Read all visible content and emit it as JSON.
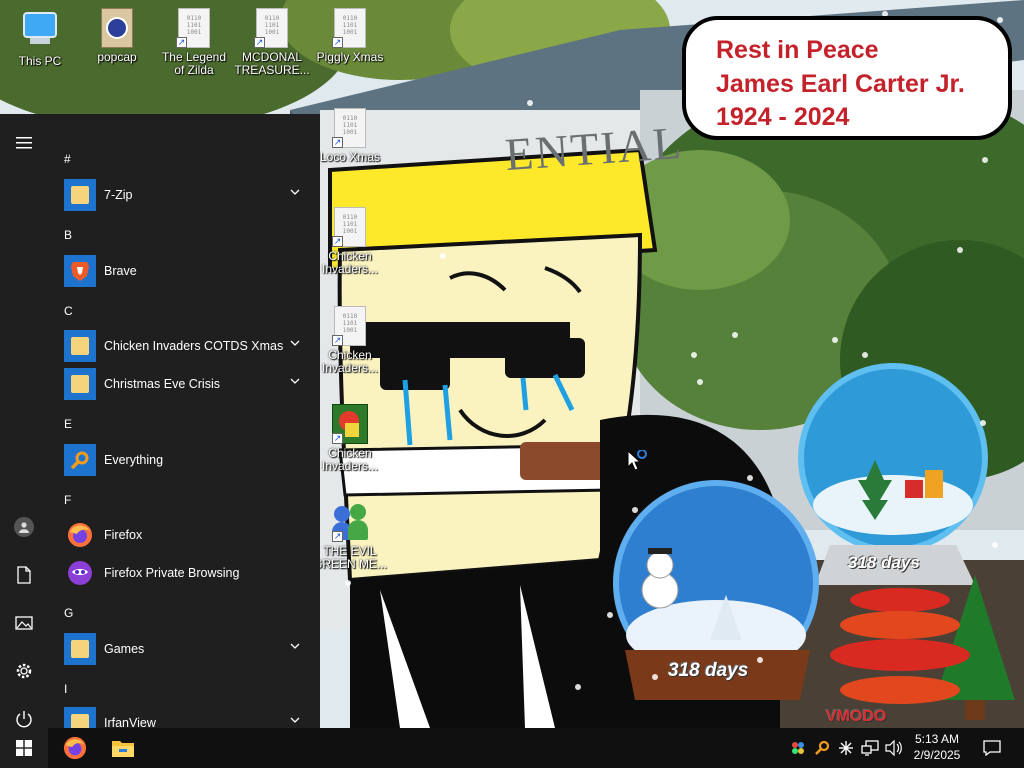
{
  "desktop": {
    "icons": [
      {
        "label": "This PC"
      },
      {
        "label": "popcap"
      },
      {
        "label": "The Legend of Zilda"
      },
      {
        "label": "MCDONAL TREASURE..."
      },
      {
        "label": "Piggly Xmas"
      },
      {
        "label": "Loco Xmas"
      },
      {
        "label": "Chicken Invaders..."
      },
      {
        "label": "Chicken Invaders..."
      },
      {
        "label": "Chicken Invaders..."
      },
      {
        "label": "THE EVIL GREEN ME..."
      }
    ]
  },
  "wallpaper": {
    "bubble": {
      "line1": "Rest in Peace",
      "line2": "James Earl Carter Jr.",
      "line3": "1924 - 2024"
    },
    "building_sign": "ENTIAL",
    "globe_days_right": "318 days",
    "globe_days_left": "318 days",
    "watermark": "VMODO"
  },
  "start_menu": {
    "groups": [
      {
        "letter": "#",
        "apps": [
          {
            "name": "7-Zip",
            "icon": "folder-icon",
            "expandable": true
          }
        ]
      },
      {
        "letter": "B",
        "apps": [
          {
            "name": "Brave",
            "icon": "brave-icon",
            "expandable": false
          }
        ]
      },
      {
        "letter": "C",
        "apps": [
          {
            "name": "Chicken Invaders COTDS Xmas",
            "icon": "folder-icon",
            "expandable": true
          },
          {
            "name": "Christmas Eve Crisis",
            "icon": "folder-icon",
            "expandable": true
          }
        ]
      },
      {
        "letter": "E",
        "apps": [
          {
            "name": "Everything",
            "icon": "everything-icon",
            "expandable": false
          }
        ]
      },
      {
        "letter": "F",
        "apps": [
          {
            "name": "Firefox",
            "icon": "firefox-icon",
            "expandable": false
          },
          {
            "name": "Firefox Private Browsing",
            "icon": "firefox-private-icon",
            "expandable": false
          }
        ]
      },
      {
        "letter": "G",
        "apps": [
          {
            "name": "Games",
            "icon": "folder-icon",
            "expandable": true
          }
        ]
      },
      {
        "letter": "I",
        "apps": [
          {
            "name": "IrfanView",
            "icon": "folder-icon",
            "expandable": true
          }
        ]
      }
    ]
  },
  "taskbar": {
    "clock_time": "5:13 AM",
    "clock_date": "2/9/2025"
  },
  "colors": {
    "start_bg": "#1f1f1f",
    "taskbar_bg": "#101010",
    "bubble_text": "#c4222b",
    "tile_blue": "#1e73cf",
    "sky": "#dfe9ee"
  }
}
